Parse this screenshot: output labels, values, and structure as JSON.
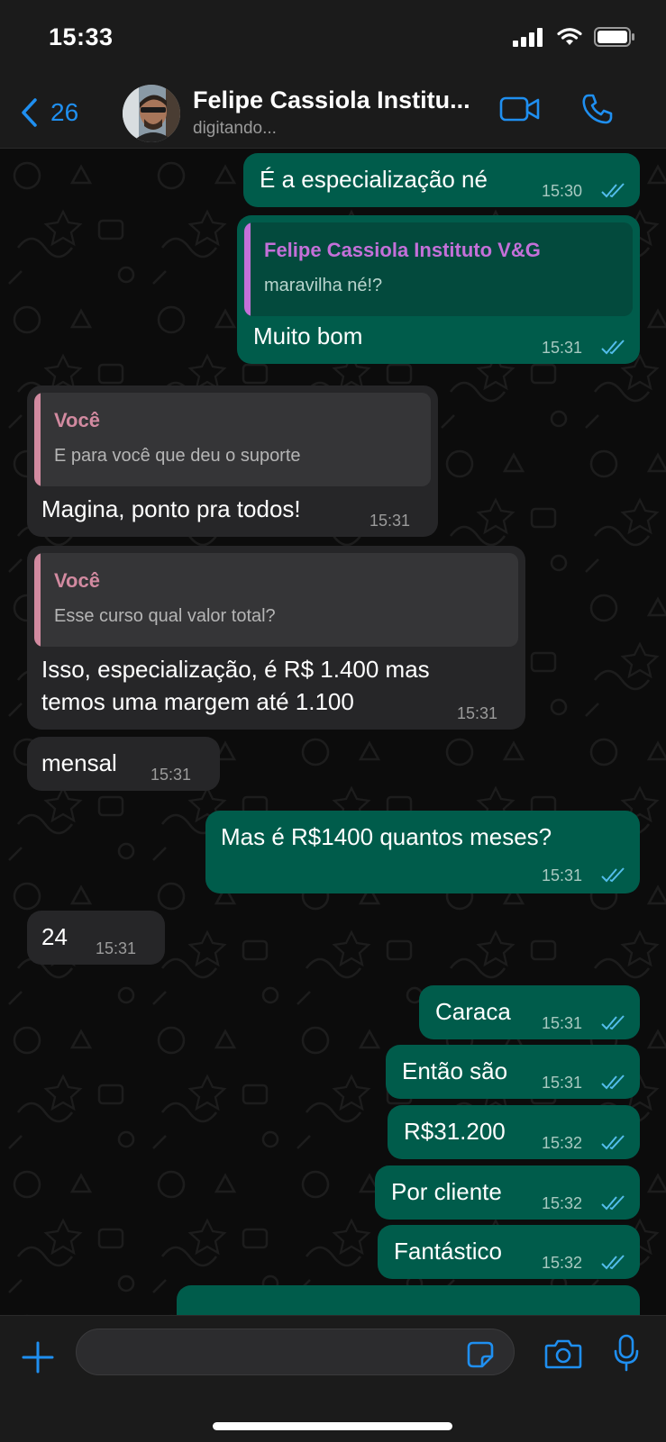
{
  "status_bar": {
    "time": "15:33"
  },
  "header": {
    "back_count": "26",
    "contact_name": "Felipe Cassiola Institu...",
    "contact_status": "digitando..."
  },
  "colors": {
    "accent": "#1f8ff0",
    "outgoing_bubble": "#005c4b",
    "incoming_bubble": "#262628",
    "quote_author_out": "#c470d9",
    "quote_author_in": "#d28aa0",
    "read_ticks": "#53bdeb"
  },
  "messages": [
    {
      "direction": "out",
      "text": "É a especialização né",
      "time": "15:30",
      "status": "read"
    },
    {
      "direction": "out",
      "quote_author": "Felipe Cassiola Instituto V&G",
      "quote_text": "maravilha né!?",
      "text": "Muito bom",
      "time": "15:31",
      "status": "read"
    },
    {
      "direction": "in",
      "quote_author": "Você",
      "quote_text": "E para você que deu o suporte",
      "text": "Magina, ponto pra todos!",
      "time": "15:31"
    },
    {
      "direction": "in",
      "quote_author": "Você",
      "quote_text": "Esse curso qual valor total?",
      "text_line1": "Isso, especialização, é R$ 1.400 mas",
      "text_line2": "temos uma margem até 1.100",
      "time": "15:31"
    },
    {
      "direction": "in",
      "text": "mensal",
      "time": "15:31"
    },
    {
      "direction": "out",
      "text": "Mas é R$1400 quantos meses?",
      "time": "15:31",
      "status": "read"
    },
    {
      "direction": "in",
      "text": "24",
      "time": "15:31"
    },
    {
      "direction": "out",
      "text": "Caraca",
      "time": "15:31",
      "status": "read"
    },
    {
      "direction": "out",
      "text": "Então são",
      "time": "15:31",
      "status": "read"
    },
    {
      "direction": "out",
      "text": "R$31.200",
      "time": "15:32",
      "status": "read"
    },
    {
      "direction": "out",
      "text": "Por cliente",
      "time": "15:32",
      "status": "read"
    },
    {
      "direction": "out",
      "text": "Fantástico",
      "time": "15:32",
      "status": "read"
    }
  ],
  "composer": {
    "input_value": "",
    "icons": [
      "plus-icon",
      "sticker-icon",
      "camera-icon",
      "microphone-icon"
    ]
  }
}
